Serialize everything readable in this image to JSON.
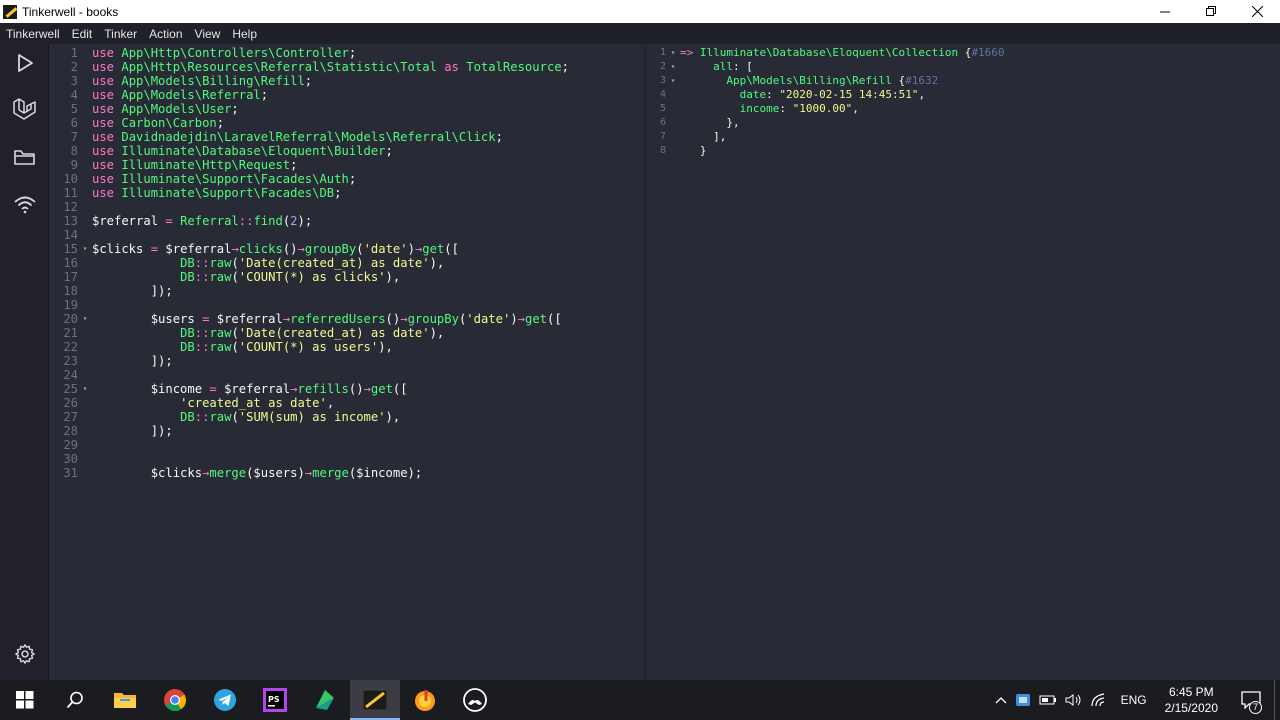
{
  "window": {
    "title": "Tinkerwell - books"
  },
  "menu": [
    "Tinkerwell",
    "Edit",
    "Tinker",
    "Action",
    "View",
    "Help"
  ],
  "sidebar": {
    "items": [
      "run-icon",
      "laravel-icon",
      "folder-icon",
      "ssh-wifi-icon"
    ],
    "bottom": "settings-icon"
  },
  "colors": {
    "keyword": "#ff79c6",
    "namespace": "#50fa7b",
    "func": "#50fa7b",
    "string": "#f1fa8c",
    "number": "#bd93f9",
    "variable": "#f8f8f2",
    "arrow": "#ff79c6",
    "comment": "#6272a4"
  },
  "editor": {
    "lines": [
      {
        "n": "1",
        "fold": "",
        "tokens": [
          [
            "kw",
            "use "
          ],
          [
            "ns",
            "App\\Http\\Controllers\\Controller"
          ],
          [
            "pl",
            ";"
          ]
        ]
      },
      {
        "n": "2",
        "fold": "",
        "tokens": [
          [
            "kw",
            "use "
          ],
          [
            "ns",
            "App\\Http\\Resources\\Referral\\Statistic\\Total "
          ],
          [
            "kw",
            "as "
          ],
          [
            "ns",
            "TotalResource"
          ],
          [
            "pl",
            ";"
          ]
        ]
      },
      {
        "n": "3",
        "fold": "",
        "tokens": [
          [
            "kw",
            "use "
          ],
          [
            "ns",
            "App\\Models\\Billing\\Refill"
          ],
          [
            "pl",
            ";"
          ]
        ]
      },
      {
        "n": "4",
        "fold": "",
        "tokens": [
          [
            "kw",
            "use "
          ],
          [
            "ns",
            "App\\Models\\Referral"
          ],
          [
            "pl",
            ";"
          ]
        ]
      },
      {
        "n": "5",
        "fold": "",
        "tokens": [
          [
            "kw",
            "use "
          ],
          [
            "ns",
            "App\\Models\\User"
          ],
          [
            "pl",
            ";"
          ]
        ]
      },
      {
        "n": "6",
        "fold": "",
        "tokens": [
          [
            "kw",
            "use "
          ],
          [
            "ns",
            "Carbon\\Carbon"
          ],
          [
            "pl",
            ";"
          ]
        ]
      },
      {
        "n": "7",
        "fold": "",
        "tokens": [
          [
            "kw",
            "use "
          ],
          [
            "ns",
            "Davidnadejdin\\LaravelReferral\\Models\\Referral\\Click"
          ],
          [
            "pl",
            ";"
          ]
        ]
      },
      {
        "n": "8",
        "fold": "",
        "tokens": [
          [
            "kw",
            "use "
          ],
          [
            "ns",
            "Illuminate\\Database\\Eloquent\\Builder"
          ],
          [
            "pl",
            ";"
          ]
        ]
      },
      {
        "n": "9",
        "fold": "",
        "tokens": [
          [
            "kw",
            "use "
          ],
          [
            "ns",
            "Illuminate\\Http\\Request"
          ],
          [
            "pl",
            ";"
          ]
        ]
      },
      {
        "n": "10",
        "fold": "",
        "tokens": [
          [
            "kw",
            "use "
          ],
          [
            "ns",
            "Illuminate\\Support\\Facades\\Auth"
          ],
          [
            "pl",
            ";"
          ]
        ]
      },
      {
        "n": "11",
        "fold": "",
        "tokens": [
          [
            "kw",
            "use "
          ],
          [
            "ns",
            "Illuminate\\Support\\Facades\\DB"
          ],
          [
            "pl",
            ";"
          ]
        ]
      },
      {
        "n": "12",
        "fold": "",
        "tokens": []
      },
      {
        "n": "13",
        "fold": "",
        "tokens": [
          [
            "pl",
            "$referral "
          ],
          [
            "kw",
            "= "
          ],
          [
            "ns",
            "Referral"
          ],
          [
            "kw",
            "::"
          ],
          [
            "fn",
            "find"
          ],
          [
            "pl",
            "("
          ],
          [
            "num",
            "2"
          ],
          [
            "pl",
            ");"
          ]
        ]
      },
      {
        "n": "14",
        "fold": "",
        "tokens": []
      },
      {
        "n": "15",
        "fold": "▾",
        "tokens": [
          [
            "pl",
            "$clicks "
          ],
          [
            "kw",
            "= "
          ],
          [
            "pl",
            "$referral"
          ],
          [
            "kw",
            "→"
          ],
          [
            "fn",
            "clicks"
          ],
          [
            "pl",
            "()"
          ],
          [
            "kw",
            "→"
          ],
          [
            "fn",
            "groupBy"
          ],
          [
            "pl",
            "("
          ],
          [
            "str",
            "'date'"
          ],
          [
            "pl",
            ")"
          ],
          [
            "kw",
            "→"
          ],
          [
            "fn",
            "get"
          ],
          [
            "pl",
            "(["
          ]
        ]
      },
      {
        "n": "16",
        "fold": "",
        "tokens": [
          [
            "pl",
            "            "
          ],
          [
            "ns",
            "DB"
          ],
          [
            "kw",
            "::"
          ],
          [
            "fn",
            "raw"
          ],
          [
            "pl",
            "("
          ],
          [
            "str",
            "'Date(created_at) as date'"
          ],
          [
            "pl",
            "),"
          ]
        ]
      },
      {
        "n": "17",
        "fold": "",
        "tokens": [
          [
            "pl",
            "            "
          ],
          [
            "ns",
            "DB"
          ],
          [
            "kw",
            "::"
          ],
          [
            "fn",
            "raw"
          ],
          [
            "pl",
            "("
          ],
          [
            "str",
            "'COUNT(*) as clicks'"
          ],
          [
            "pl",
            "),"
          ]
        ]
      },
      {
        "n": "18",
        "fold": "",
        "tokens": [
          [
            "pl",
            "        ]);"
          ]
        ]
      },
      {
        "n": "19",
        "fold": "",
        "tokens": []
      },
      {
        "n": "20",
        "fold": "▾",
        "tokens": [
          [
            "pl",
            "        $users "
          ],
          [
            "kw",
            "= "
          ],
          [
            "pl",
            "$referral"
          ],
          [
            "kw",
            "→"
          ],
          [
            "fn",
            "referredUsers"
          ],
          [
            "pl",
            "()"
          ],
          [
            "kw",
            "→"
          ],
          [
            "fn",
            "groupBy"
          ],
          [
            "pl",
            "("
          ],
          [
            "str",
            "'date'"
          ],
          [
            "pl",
            ")"
          ],
          [
            "kw",
            "→"
          ],
          [
            "fn",
            "get"
          ],
          [
            "pl",
            "(["
          ]
        ]
      },
      {
        "n": "21",
        "fold": "",
        "tokens": [
          [
            "pl",
            "            "
          ],
          [
            "ns",
            "DB"
          ],
          [
            "kw",
            "::"
          ],
          [
            "fn",
            "raw"
          ],
          [
            "pl",
            "("
          ],
          [
            "str",
            "'Date(created_at) as date'"
          ],
          [
            "pl",
            "),"
          ]
        ]
      },
      {
        "n": "22",
        "fold": "",
        "tokens": [
          [
            "pl",
            "            "
          ],
          [
            "ns",
            "DB"
          ],
          [
            "kw",
            "::"
          ],
          [
            "fn",
            "raw"
          ],
          [
            "pl",
            "("
          ],
          [
            "str",
            "'COUNT(*) as users'"
          ],
          [
            "pl",
            "),"
          ]
        ]
      },
      {
        "n": "23",
        "fold": "",
        "tokens": [
          [
            "pl",
            "        ]);"
          ]
        ]
      },
      {
        "n": "24",
        "fold": "",
        "tokens": []
      },
      {
        "n": "25",
        "fold": "▾",
        "tokens": [
          [
            "pl",
            "        $income "
          ],
          [
            "kw",
            "= "
          ],
          [
            "pl",
            "$referral"
          ],
          [
            "kw",
            "→"
          ],
          [
            "fn",
            "refills"
          ],
          [
            "pl",
            "()"
          ],
          [
            "kw",
            "→"
          ],
          [
            "fn",
            "get"
          ],
          [
            "pl",
            "(["
          ]
        ]
      },
      {
        "n": "26",
        "fold": "",
        "tokens": [
          [
            "pl",
            "            "
          ],
          [
            "str",
            "'created_at as date'"
          ],
          [
            "pl",
            ","
          ]
        ]
      },
      {
        "n": "27",
        "fold": "",
        "tokens": [
          [
            "pl",
            "            "
          ],
          [
            "ns",
            "DB"
          ],
          [
            "kw",
            "::"
          ],
          [
            "fn",
            "raw"
          ],
          [
            "pl",
            "("
          ],
          [
            "str",
            "'SUM(sum) as income'"
          ],
          [
            "pl",
            "),"
          ]
        ]
      },
      {
        "n": "28",
        "fold": "",
        "tokens": [
          [
            "pl",
            "        ]);"
          ]
        ]
      },
      {
        "n": "29",
        "fold": "",
        "tokens": []
      },
      {
        "n": "30",
        "fold": "",
        "tokens": []
      },
      {
        "n": "31",
        "fold": "",
        "tokens": [
          [
            "pl",
            "        $clicks"
          ],
          [
            "kw",
            "→"
          ],
          [
            "fn",
            "merge"
          ],
          [
            "pl",
            "($users)"
          ],
          [
            "kw",
            "→"
          ],
          [
            "fn",
            "merge"
          ],
          [
            "pl",
            "($income);"
          ]
        ]
      }
    ]
  },
  "output": {
    "lines": [
      {
        "n": "1",
        "fold": "▾",
        "tokens": [
          [
            "kw",
            "=> "
          ],
          [
            "ns",
            "Illuminate\\Database\\Eloquent\\Collection "
          ],
          [
            "pl",
            "{"
          ],
          [
            "cm",
            "#1660"
          ]
        ]
      },
      {
        "n": "2",
        "fold": "▾",
        "tokens": [
          [
            "pl",
            "     "
          ],
          [
            "ns",
            "all"
          ],
          [
            "pl",
            ": ["
          ]
        ]
      },
      {
        "n": "3",
        "fold": "▾",
        "tokens": [
          [
            "pl",
            "       "
          ],
          [
            "ns",
            "App\\Models\\Billing\\Refill "
          ],
          [
            "pl",
            "{"
          ],
          [
            "cm",
            "#1632"
          ]
        ]
      },
      {
        "n": "4",
        "fold": "",
        "tokens": [
          [
            "pl",
            "         "
          ],
          [
            "ns",
            "date"
          ],
          [
            "pl",
            ": "
          ],
          [
            "str",
            "\"2020-02-15 14:45:51\""
          ],
          [
            "pl",
            ","
          ]
        ]
      },
      {
        "n": "5",
        "fold": "",
        "tokens": [
          [
            "pl",
            "         "
          ],
          [
            "ns",
            "income"
          ],
          [
            "pl",
            ": "
          ],
          [
            "str",
            "\"1000.00\""
          ],
          [
            "pl",
            ","
          ]
        ]
      },
      {
        "n": "6",
        "fold": "",
        "tokens": [
          [
            "pl",
            "       },"
          ]
        ]
      },
      {
        "n": "7",
        "fold": "",
        "tokens": [
          [
            "pl",
            "     ],"
          ]
        ]
      },
      {
        "n": "8",
        "fold": "",
        "tokens": [
          [
            "pl",
            "   }"
          ]
        ]
      }
    ]
  },
  "taskbar": {
    "apps": [
      "windows-start-icon",
      "search-icon",
      "file-explorer-icon",
      "chrome-icon",
      "telegram-icon",
      "phpstorm-icon",
      "sublime-icon",
      "tinkerwell-icon",
      "music-icon",
      "xbox-icon"
    ],
    "active": "tinkerwell-icon",
    "tray": {
      "language": "ENG",
      "time": "6:45 PM",
      "date": "2/15/2020",
      "notifications": "7"
    }
  }
}
